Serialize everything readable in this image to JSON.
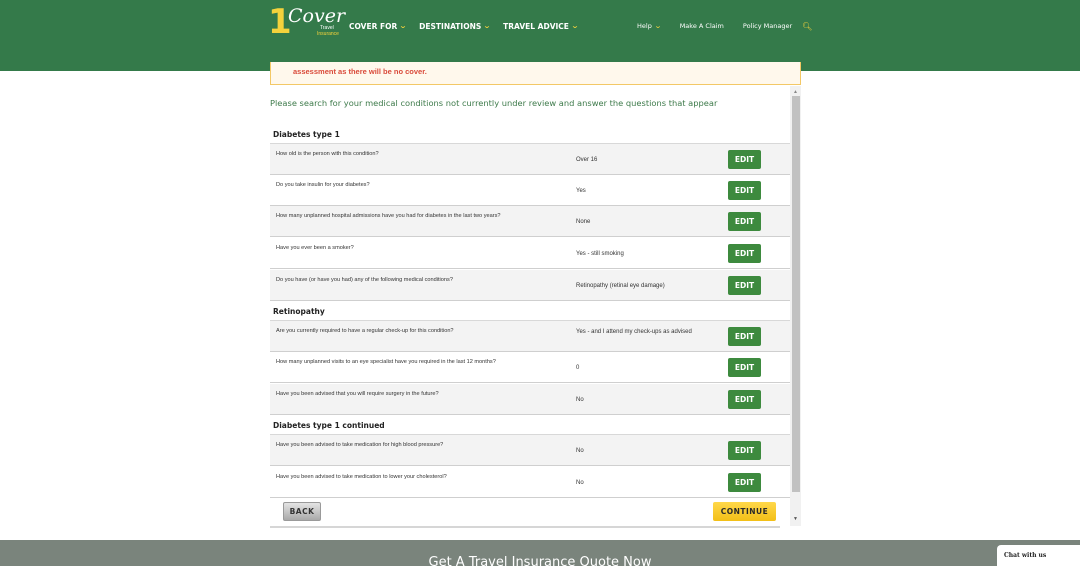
{
  "header": {
    "logo": {
      "number": "1",
      "word": "Cover",
      "line1": "Travel",
      "line2": "Insurance"
    },
    "nav_left": [
      {
        "label": "COVER FOR",
        "icon": "chevron-down-icon"
      },
      {
        "label": "DESTINATIONS",
        "icon": "chevron-down-icon"
      },
      {
        "label": "TRAVEL ADVICE",
        "icon": "chevron-down-icon"
      }
    ],
    "nav_right": [
      {
        "label": "Help",
        "icon": "chevron-down-icon"
      },
      {
        "label": "Make A Claim"
      },
      {
        "label": "Policy Manager"
      }
    ],
    "search_icon": "search-icon",
    "colors": {
      "brand_green": "#347a4a",
      "accent_yellow": "#f4d23c"
    }
  },
  "warning": {
    "text": "assessment as there will be no cover."
  },
  "main": {
    "intro": "Please search for your medical conditions not currently under review and answer the questions that appear",
    "sections": [
      {
        "title": "Diabetes type 1",
        "rows": [
          {
            "question": "How old is the person with this condition?",
            "answer": "Over 16",
            "action": "EDIT"
          },
          {
            "question": "Do you take insulin for your diabetes?",
            "answer": "Yes",
            "action": "EDIT"
          },
          {
            "question": "How many unplanned hospital admissions have you had for diabetes in the last two years?",
            "answer": "None",
            "action": "EDIT"
          },
          {
            "question": "Have you ever been a smoker?",
            "answer": "Yes - still smoking",
            "action": "EDIT"
          },
          {
            "question": "Do you have (or have you had) any of the following medical conditions?",
            "answer": "Retinopathy (retinal eye damage)",
            "action": "EDIT"
          }
        ]
      },
      {
        "title": "Retinopathy",
        "rows": [
          {
            "question": "Are you currently required to have a regular check-up for this condition?",
            "answer": "Yes - and I attend my check-ups as advised",
            "action": "EDIT"
          },
          {
            "question": "How many unplanned visits to an eye specialist have you required in the last 12 months?",
            "answer": "0",
            "action": "EDIT"
          },
          {
            "question": "Have you been advised that you will require surgery in the future?",
            "answer": "No",
            "action": "EDIT"
          }
        ]
      },
      {
        "title": "Diabetes type 1 continued",
        "rows": [
          {
            "question": "Have you been advised to take medication for high blood pressure?",
            "answer": "No",
            "action": "EDIT"
          },
          {
            "question": "Have you been advised to take medication to lower your cholesterol?",
            "answer": "No",
            "action": "EDIT"
          }
        ]
      }
    ],
    "back_label": "BACK",
    "continue_label": "CONTINUE"
  },
  "footer": {
    "cta": "Get A Travel Insurance Quote Now"
  },
  "chat": {
    "label": "Chat with us"
  }
}
